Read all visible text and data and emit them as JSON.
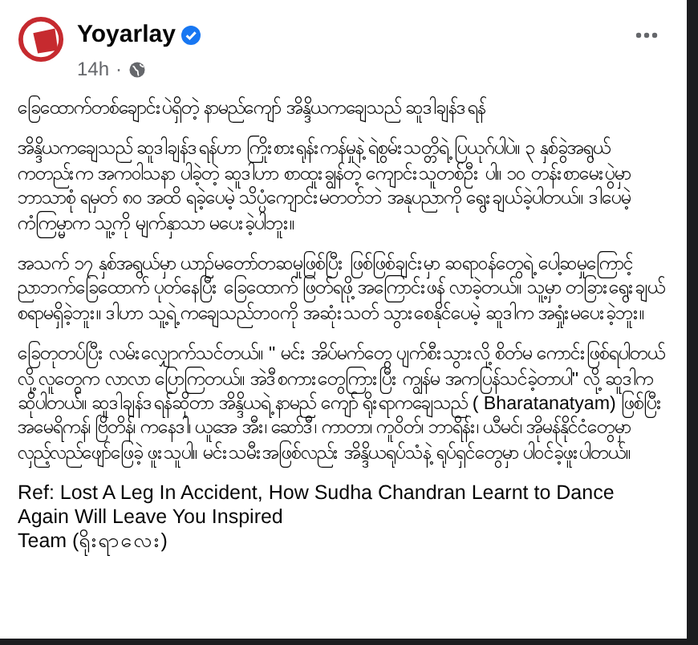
{
  "post": {
    "author": "Yoyarlay",
    "verified": true,
    "time": "14h",
    "separator": "·",
    "title": "ခြေထောက်တစ်ချောင်းပဲရှိတဲ့ နာမည်ကျော် အိန္ဒိယကချေသည် ဆူဒါချန်ဒရန်",
    "paragraphs": [
      "အိန္ဒိယကချေသည် ဆူဒါချန်ဒရန်ဟာ ကြိုးစားရုန်းကန်မှုနဲ့ ရဲစွမ်းသတ္တိရဲ့ ပြယုဂ်ပါပဲ။ ၃ နှစ်ခွဲအရွယ်ကတည်းက အကဝါသနာ ပါခဲ့တဲ့ ဆူဒါဟာ စာထူးချွန်တဲ့ ကျောင်းသူတစ်ဦး ပါ။ ၁၀ တန်းစာမေးပွဲမှာ ဘာသာစုံ ရမှတ် ၈၀ အထိ ရခဲ့ပေမဲ့ သိပ္ပံကျောင်းမတတ်ဘဲ အနုပညာကို ရွေးချယ်ခဲ့ပါတယ်။ ဒါပေမဲ့ ကံကြမ္မာက သူ့ကို မျက်နှာသာ မပေးခဲ့ပါဘူး။",
      "အသက် ၁၇ နှစ်အရွယ်မှာ ယာဉ်မတော်တဆမှုဖြစ်ပြီး ဖြစ်ဖြစ်ချင်းမှာ ဆရာဝန်တွေရဲ့ ပေါ့ဆမှုကြောင့် ညာဘက်ခြေထောက် ပုတ်နေပြီး ခြေထောက် ဖြတ်ရဖို့ အကြောင်းဖန် လာခဲ့တယ်။ သူ့မှာ တခြားရွေးချယ်စရာမရှိခဲ့ဘူး။ ဒါဟာ သူ့ရဲ့ ကချေသည်ဘဝကို အဆုံးသတ် သွားစေနိုင်ပေမဲ့ ဆူဒါက အရှုံးမပေးခဲ့ဘူး။",
      "ခြေတုတပ်ပြီး လမ်းလျှောက်သင်တယ်။ \" မင်း အိပ်မက်တွေ ပျက်စီးသွားလို့ စိတ်မ ကောင်းဖြစ်ရပါတယ်လို့ လူတွေက လာလာ ပြောကြတယ်။ အဲဒီစကားတွေကြားပြီး ကျွန်မ အကပြန်သင်ခဲ့တာပါ\" လို့ ဆူဒါက ဆိုပါတယ်။ ဆူဒါချန်ဒရန်ဆိုတာ အိန္ဒိယရဲ့ နာမည် ကျော် ရိုးရာကချေသည် ( Bharatanatyam) ဖြစ်ပြီး အမေရိကန်၊ ဗြိတိန်၊ ကနေဒါ၊ ယူအေ အီး၊ ဆော်ဒီ၊ ကာတာ၊ ကူဝိတ်၊ ဘာရိန်း၊ ယီမင်၊ အိုမန်နိုင်ငံတွေမှာ လှည့်လည်ဖျော်ဖြေခဲ့ ဖူးသူပါ။ မင်းသမီးအဖြစ်လည်း အိန္ဒိယရုပ်သံနဲ့ ရုပ်ရှင်တွေမှာ ပါဝင်ခဲ့ဖူးပါတယ်။"
    ],
    "ref": "Ref: Lost A Leg In Accident, How Sudha Chandran Learnt to Dance Again Will Leave You Inspired",
    "credit": "Team (ရိုးရာလေး)"
  }
}
